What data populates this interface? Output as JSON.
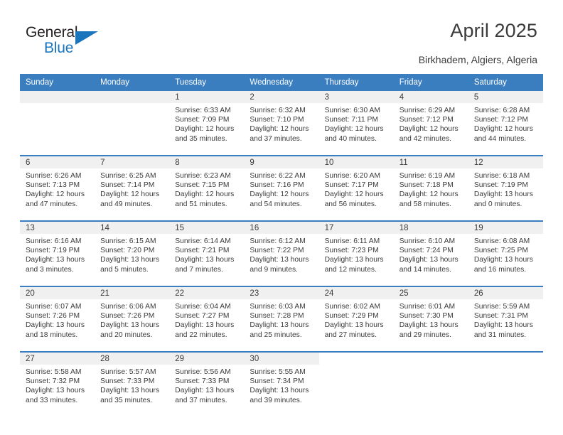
{
  "branding": {
    "logo_primary": "General",
    "logo_secondary": "Blue",
    "accent_color": "#1b75bc"
  },
  "header": {
    "title": "April 2025",
    "subtitle": "Birkhadem, Algiers, Algeria",
    "header_bg_color": "#3a7ebf",
    "daynum_band_color": "#f0f0f0"
  },
  "calendar": {
    "weekday_headers": [
      "Sunday",
      "Monday",
      "Tuesday",
      "Wednesday",
      "Thursday",
      "Friday",
      "Saturday"
    ],
    "labels": {
      "sunrise_prefix": "Sunrise:",
      "sunset_prefix": "Sunset:",
      "daylight_prefix": "Daylight:"
    },
    "weeks": [
      [
        {
          "day": "",
          "sunrise": "",
          "sunset": "",
          "daylight_line1": "",
          "daylight_line2": ""
        },
        {
          "day": "",
          "sunrise": "",
          "sunset": "",
          "daylight_line1": "",
          "daylight_line2": ""
        },
        {
          "day": "1",
          "sunrise": "Sunrise: 6:33 AM",
          "sunset": "Sunset: 7:09 PM",
          "daylight_line1": "Daylight: 12 hours",
          "daylight_line2": "and 35 minutes."
        },
        {
          "day": "2",
          "sunrise": "Sunrise: 6:32 AM",
          "sunset": "Sunset: 7:10 PM",
          "daylight_line1": "Daylight: 12 hours",
          "daylight_line2": "and 37 minutes."
        },
        {
          "day": "3",
          "sunrise": "Sunrise: 6:30 AM",
          "sunset": "Sunset: 7:11 PM",
          "daylight_line1": "Daylight: 12 hours",
          "daylight_line2": "and 40 minutes."
        },
        {
          "day": "4",
          "sunrise": "Sunrise: 6:29 AM",
          "sunset": "Sunset: 7:12 PM",
          "daylight_line1": "Daylight: 12 hours",
          "daylight_line2": "and 42 minutes."
        },
        {
          "day": "5",
          "sunrise": "Sunrise: 6:28 AM",
          "sunset": "Sunset: 7:12 PM",
          "daylight_line1": "Daylight: 12 hours",
          "daylight_line2": "and 44 minutes."
        }
      ],
      [
        {
          "day": "6",
          "sunrise": "Sunrise: 6:26 AM",
          "sunset": "Sunset: 7:13 PM",
          "daylight_line1": "Daylight: 12 hours",
          "daylight_line2": "and 47 minutes."
        },
        {
          "day": "7",
          "sunrise": "Sunrise: 6:25 AM",
          "sunset": "Sunset: 7:14 PM",
          "daylight_line1": "Daylight: 12 hours",
          "daylight_line2": "and 49 minutes."
        },
        {
          "day": "8",
          "sunrise": "Sunrise: 6:23 AM",
          "sunset": "Sunset: 7:15 PM",
          "daylight_line1": "Daylight: 12 hours",
          "daylight_line2": "and 51 minutes."
        },
        {
          "day": "9",
          "sunrise": "Sunrise: 6:22 AM",
          "sunset": "Sunset: 7:16 PM",
          "daylight_line1": "Daylight: 12 hours",
          "daylight_line2": "and 54 minutes."
        },
        {
          "day": "10",
          "sunrise": "Sunrise: 6:20 AM",
          "sunset": "Sunset: 7:17 PM",
          "daylight_line1": "Daylight: 12 hours",
          "daylight_line2": "and 56 minutes."
        },
        {
          "day": "11",
          "sunrise": "Sunrise: 6:19 AM",
          "sunset": "Sunset: 7:18 PM",
          "daylight_line1": "Daylight: 12 hours",
          "daylight_line2": "and 58 minutes."
        },
        {
          "day": "12",
          "sunrise": "Sunrise: 6:18 AM",
          "sunset": "Sunset: 7:19 PM",
          "daylight_line1": "Daylight: 13 hours",
          "daylight_line2": "and 0 minutes."
        }
      ],
      [
        {
          "day": "13",
          "sunrise": "Sunrise: 6:16 AM",
          "sunset": "Sunset: 7:19 PM",
          "daylight_line1": "Daylight: 13 hours",
          "daylight_line2": "and 3 minutes."
        },
        {
          "day": "14",
          "sunrise": "Sunrise: 6:15 AM",
          "sunset": "Sunset: 7:20 PM",
          "daylight_line1": "Daylight: 13 hours",
          "daylight_line2": "and 5 minutes."
        },
        {
          "day": "15",
          "sunrise": "Sunrise: 6:14 AM",
          "sunset": "Sunset: 7:21 PM",
          "daylight_line1": "Daylight: 13 hours",
          "daylight_line2": "and 7 minutes."
        },
        {
          "day": "16",
          "sunrise": "Sunrise: 6:12 AM",
          "sunset": "Sunset: 7:22 PM",
          "daylight_line1": "Daylight: 13 hours",
          "daylight_line2": "and 9 minutes."
        },
        {
          "day": "17",
          "sunrise": "Sunrise: 6:11 AM",
          "sunset": "Sunset: 7:23 PM",
          "daylight_line1": "Daylight: 13 hours",
          "daylight_line2": "and 12 minutes."
        },
        {
          "day": "18",
          "sunrise": "Sunrise: 6:10 AM",
          "sunset": "Sunset: 7:24 PM",
          "daylight_line1": "Daylight: 13 hours",
          "daylight_line2": "and 14 minutes."
        },
        {
          "day": "19",
          "sunrise": "Sunrise: 6:08 AM",
          "sunset": "Sunset: 7:25 PM",
          "daylight_line1": "Daylight: 13 hours",
          "daylight_line2": "and 16 minutes."
        }
      ],
      [
        {
          "day": "20",
          "sunrise": "Sunrise: 6:07 AM",
          "sunset": "Sunset: 7:26 PM",
          "daylight_line1": "Daylight: 13 hours",
          "daylight_line2": "and 18 minutes."
        },
        {
          "day": "21",
          "sunrise": "Sunrise: 6:06 AM",
          "sunset": "Sunset: 7:26 PM",
          "daylight_line1": "Daylight: 13 hours",
          "daylight_line2": "and 20 minutes."
        },
        {
          "day": "22",
          "sunrise": "Sunrise: 6:04 AM",
          "sunset": "Sunset: 7:27 PM",
          "daylight_line1": "Daylight: 13 hours",
          "daylight_line2": "and 22 minutes."
        },
        {
          "day": "23",
          "sunrise": "Sunrise: 6:03 AM",
          "sunset": "Sunset: 7:28 PM",
          "daylight_line1": "Daylight: 13 hours",
          "daylight_line2": "and 25 minutes."
        },
        {
          "day": "24",
          "sunrise": "Sunrise: 6:02 AM",
          "sunset": "Sunset: 7:29 PM",
          "daylight_line1": "Daylight: 13 hours",
          "daylight_line2": "and 27 minutes."
        },
        {
          "day": "25",
          "sunrise": "Sunrise: 6:01 AM",
          "sunset": "Sunset: 7:30 PM",
          "daylight_line1": "Daylight: 13 hours",
          "daylight_line2": "and 29 minutes."
        },
        {
          "day": "26",
          "sunrise": "Sunrise: 5:59 AM",
          "sunset": "Sunset: 7:31 PM",
          "daylight_line1": "Daylight: 13 hours",
          "daylight_line2": "and 31 minutes."
        }
      ],
      [
        {
          "day": "27",
          "sunrise": "Sunrise: 5:58 AM",
          "sunset": "Sunset: 7:32 PM",
          "daylight_line1": "Daylight: 13 hours",
          "daylight_line2": "and 33 minutes."
        },
        {
          "day": "28",
          "sunrise": "Sunrise: 5:57 AM",
          "sunset": "Sunset: 7:33 PM",
          "daylight_line1": "Daylight: 13 hours",
          "daylight_line2": "and 35 minutes."
        },
        {
          "day": "29",
          "sunrise": "Sunrise: 5:56 AM",
          "sunset": "Sunset: 7:33 PM",
          "daylight_line1": "Daylight: 13 hours",
          "daylight_line2": "and 37 minutes."
        },
        {
          "day": "30",
          "sunrise": "Sunrise: 5:55 AM",
          "sunset": "Sunset: 7:34 PM",
          "daylight_line1": "Daylight: 13 hours",
          "daylight_line2": "and 39 minutes."
        },
        {
          "day": "",
          "sunrise": "",
          "sunset": "",
          "daylight_line1": "",
          "daylight_line2": ""
        },
        {
          "day": "",
          "sunrise": "",
          "sunset": "",
          "daylight_line1": "",
          "daylight_line2": ""
        },
        {
          "day": "",
          "sunrise": "",
          "sunset": "",
          "daylight_line1": "",
          "daylight_line2": ""
        }
      ]
    ]
  }
}
